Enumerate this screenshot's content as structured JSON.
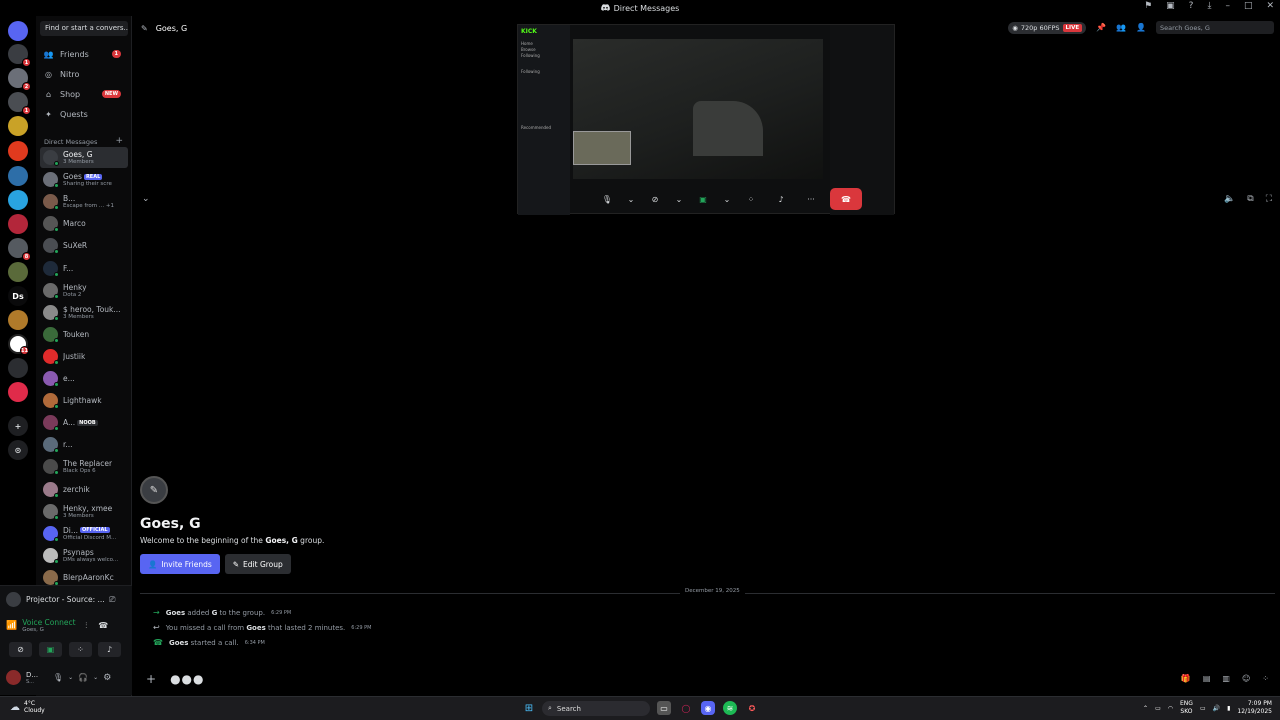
{
  "titlebar": {
    "title": "Direct Messages"
  },
  "servers": [
    {
      "label": "",
      "badge": "",
      "color": "#5865f2"
    },
    {
      "label": "",
      "badge": "1",
      "color": "#3a3d42"
    },
    {
      "label": "",
      "badge": "2",
      "color": "#6b6f78"
    },
    {
      "label": "",
      "badge": "1",
      "color": "#4a4d52"
    },
    {
      "label": "",
      "badge": "",
      "color": "#c9a227"
    },
    {
      "label": "",
      "badge": "",
      "color": "#e03a1e"
    },
    {
      "label": "",
      "badge": "",
      "color": "#2d6ea8"
    },
    {
      "label": "",
      "badge": "",
      "color": "#29a3e0"
    },
    {
      "label": "",
      "badge": "",
      "color": "#b3263a"
    },
    {
      "label": "",
      "badge": "8",
      "color": "#555a60"
    },
    {
      "label": "",
      "badge": "",
      "color": "#5a6a3a"
    },
    {
      "label": "Ds",
      "badge": "",
      "color": "#0a0a0b"
    },
    {
      "label": "",
      "badge": "",
      "color": "#b07a2a"
    },
    {
      "label": "",
      "badge": "11",
      "color": "#ffffff"
    },
    {
      "label": "",
      "badge": "",
      "color": "#2b2d31"
    },
    {
      "label": "",
      "badge": "",
      "color": "#e02b4a"
    }
  ],
  "sidebar": {
    "search_label": "Find or start a convers...",
    "nav": [
      {
        "label": "Friends",
        "badge": "1",
        "icon": "friends-icon"
      },
      {
        "label": "Nitro",
        "badge": "",
        "icon": "nitro-icon"
      },
      {
        "label": "Shop",
        "badge": "NEW",
        "icon": "shop-icon"
      },
      {
        "label": "Quests",
        "badge": "",
        "icon": "quests-icon"
      }
    ],
    "dm_header": "Direct Messages",
    "dms": [
      {
        "name": "Goes, G",
        "sub": "3 Members",
        "tag": "",
        "tagColor": "",
        "color": "#3a3d42",
        "active": true
      },
      {
        "name": "Goes",
        "sub": "Sharing their scre",
        "tag": "REAL",
        "tagColor": "#5865f2",
        "color": "#6b6f78",
        "active": false
      },
      {
        "name": "B...",
        "sub": "Escape from ...  +1",
        "tag": "",
        "tagColor": "",
        "color": "#7a5a4a",
        "active": false
      },
      {
        "name": "Marco",
        "sub": "",
        "tag": "",
        "tagColor": "",
        "color": "#555",
        "active": false
      },
      {
        "name": "SuXeR",
        "sub": "",
        "tag": "",
        "tagColor": "",
        "color": "#4a4d52",
        "active": false
      },
      {
        "name": "F...",
        "sub": "",
        "tag": "",
        "tagColor": "",
        "color": "#1e2a3a",
        "active": false
      },
      {
        "name": "Henky",
        "sub": "Dota 2",
        "tag": "",
        "tagColor": "",
        "color": "#6a6a6a",
        "active": false
      },
      {
        "name": "$ heroo, Touk...",
        "sub": "3 Members",
        "tag": "",
        "tagColor": "",
        "color": "#8a8a8a",
        "active": false
      },
      {
        "name": "Touken",
        "sub": "",
        "tag": "",
        "tagColor": "",
        "color": "#3a6a3a",
        "active": false
      },
      {
        "name": "Justiik",
        "sub": "",
        "tag": "",
        "tagColor": "",
        "color": "#e02b2b",
        "active": false
      },
      {
        "name": "e...",
        "sub": "",
        "tag": "",
        "tagColor": "",
        "color": "#8a5ab0",
        "active": false
      },
      {
        "name": "Lighthawk",
        "sub": "",
        "tag": "",
        "tagColor": "",
        "color": "#b06a3a",
        "active": false
      },
      {
        "name": "A...",
        "sub": "",
        "tag": "NOOB",
        "tagColor": "#2b2d31",
        "color": "#7a3a5a",
        "active": false
      },
      {
        "name": "r...",
        "sub": "",
        "tag": "",
        "tagColor": "",
        "color": "#5a6a7a",
        "active": false
      },
      {
        "name": "The Replacer",
        "sub": "Black Ops 6",
        "tag": "",
        "tagColor": "",
        "color": "#4a4a4a",
        "active": false
      },
      {
        "name": "zerchik",
        "sub": "",
        "tag": "",
        "tagColor": "",
        "color": "#9a7a8a",
        "active": false
      },
      {
        "name": "Henky, xmee",
        "sub": "3 Members",
        "tag": "",
        "tagColor": "",
        "color": "#6a6a6a",
        "active": false
      },
      {
        "name": "Di...",
        "sub": "Official Discord M...",
        "tag": "OFFICIAL",
        "tagColor": "#5865f2",
        "color": "#5865f2",
        "active": false
      },
      {
        "name": "Psynaps",
        "sub": "DMs always welco...",
        "tag": "",
        "tagColor": "",
        "color": "#bbbbbb",
        "active": false
      },
      {
        "name": "BlerpAaronKc",
        "sub": "",
        "tag": "",
        "tagColor": "",
        "color": "#8a6a4a",
        "active": false
      }
    ]
  },
  "panel": {
    "projector": "Projector - Source: ...",
    "voice_status": "Voice Connected",
    "voice_sub": "Goes, G",
    "user_name": "D...",
    "user_status": "S..."
  },
  "header": {
    "channel": "Goes, G",
    "quality": "720p 60FPS",
    "live": "LIVE",
    "search_placeholder": "Search Goes, G"
  },
  "stream": {
    "kick_label": "KICK",
    "sidebar_items": [
      "Home",
      "Browse",
      "Following",
      "Following",
      "Recommended"
    ]
  },
  "welcome": {
    "title": "Goes, G",
    "desc_prefix": "Welcome to the beginning of the ",
    "desc_group": "Goes, G",
    "desc_suffix": " group.",
    "invite_label": "Invite Friends",
    "edit_label": "Edit Group"
  },
  "messages": {
    "date": "December 19, 2025",
    "items": [
      {
        "actor": "Goes",
        "text1": " added ",
        "target": "G",
        "text2": " to the group.",
        "time": "6:29 PM",
        "icon": "arrow-right-icon",
        "iconColor": "#23a55a"
      },
      {
        "actor": "",
        "text1": "You missed a call from ",
        "target": "Goes",
        "text2": " that lasted 2 minutes.",
        "time": "6:29 PM",
        "icon": "phone-missed-icon",
        "iconColor": "#b5bac1"
      },
      {
        "actor": "Goes",
        "text1": " started a call.",
        "target": "",
        "text2": "",
        "time": "6:34 PM",
        "icon": "phone-icon",
        "iconColor": "#23a55a"
      }
    ]
  },
  "taskbar": {
    "temp": "4°C",
    "weather": "Cloudy",
    "search_label": "Search",
    "lang1": "ENG",
    "lang2": "SKO",
    "time": "7:09 PM",
    "date": "12/19/2025"
  },
  "colors": {
    "blurple": "#5865f2",
    "green": "#23a55a",
    "red": "#da373c"
  }
}
